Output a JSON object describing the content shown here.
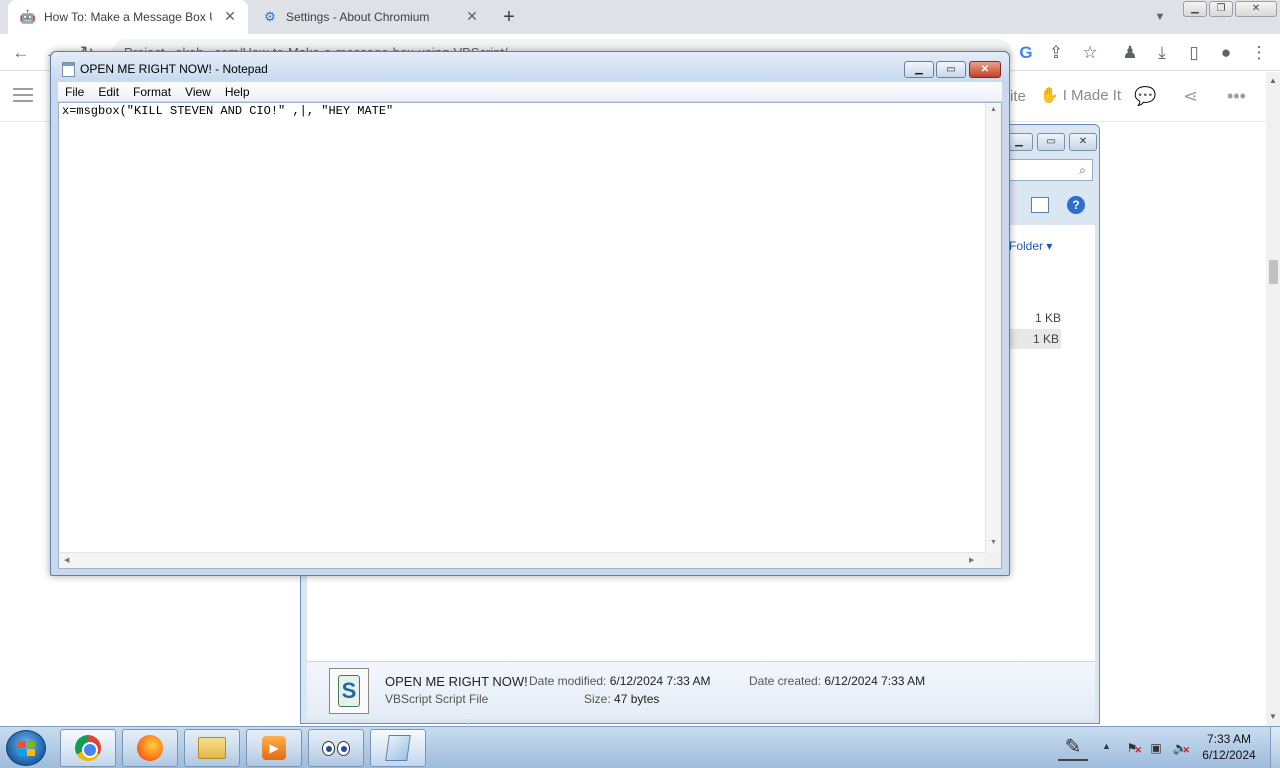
{
  "browser": {
    "tabs": [
      {
        "title": "How To: Make a Message Box Us",
        "active": true
      },
      {
        "title": "Settings - About Chromium",
        "active": false
      }
    ],
    "address": "Project...ekah...com/How-to-Make-a-message-box-using-VBScript/"
  },
  "page": {
    "toolbar_partial": "ite",
    "made_it": "I Made It"
  },
  "notepad": {
    "title": "OPEN ME RIGHT NOW! - Notepad",
    "menu": [
      "File",
      "Edit",
      "Format",
      "View",
      "Help"
    ],
    "content": "x=msgbox(\"KILL STEVEN AND CIO!\" ,|, \"HEY MATE\""
  },
  "explorer": {
    "toolbar_label": "Folder",
    "file_sizes": [
      "1 KB",
      "1 KB"
    ],
    "details": {
      "name": "OPEN ME RIGHT NOW!",
      "type": "VBScript Script File",
      "modified_label": "Date modified:",
      "modified_value": "6/12/2024 7:33 AM",
      "created_label": "Date created:",
      "created_value": "6/12/2024 7:33 AM",
      "size_label": "Size:",
      "size_value": "47 bytes"
    }
  },
  "taskbar": {
    "apps": [
      "chromium",
      "firefox",
      "windows-explorer",
      "media-player",
      "xeyes",
      "notepad"
    ],
    "time": "7:33 AM",
    "date": "6/12/2024"
  },
  "colors": {
    "titlebar": "#c5d8ee",
    "close_button": "#c4412a",
    "taskbar": "#9fbcdc",
    "link_blue": "#1e5aa8"
  }
}
